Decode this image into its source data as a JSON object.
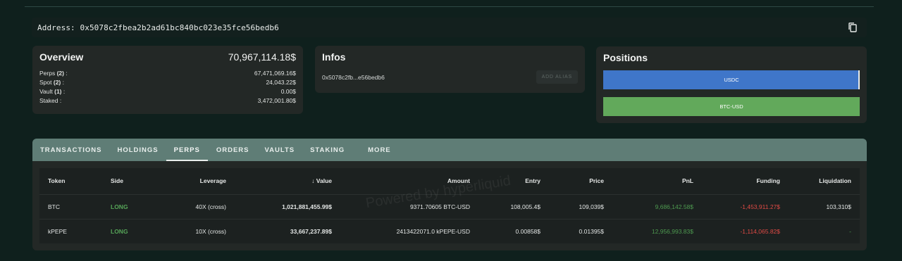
{
  "address_bar": {
    "label": "Address:",
    "value": "0x5078c2fbea2b2ad61bc840bc023e35fce56bedb6",
    "copy_icon": "copy-icon"
  },
  "overview": {
    "title": "Overview",
    "total": "70,967,114.18$",
    "rows": [
      {
        "label": "Perps",
        "count": "(2)",
        "suffix": " :",
        "value": "67,471,069.16$"
      },
      {
        "label": "Spot",
        "count": "(2)",
        "suffix": " :",
        "value": "24,043.22$"
      },
      {
        "label": "Vault",
        "count": "(1)",
        "suffix": " :",
        "value": "0.00$"
      },
      {
        "label": "Staked",
        "count": "",
        "suffix": " :",
        "value": "3,472,001.80$"
      }
    ]
  },
  "infos": {
    "title": "Infos",
    "short_address": "0x5078c2fb...e56bedb6",
    "alias_button": "ADD ALIAS"
  },
  "positions": {
    "title": "Positions",
    "bars": [
      {
        "label": "USDC",
        "color": "#3f76c9"
      },
      {
        "label": "BTC-USD",
        "color": "#62a95b"
      }
    ]
  },
  "tabs": [
    "TRANSACTIONS",
    "HOLDINGS",
    "PERPS",
    "ORDERS",
    "VAULTS",
    "STAKING",
    "MORE"
  ],
  "active_tab": "PERPS",
  "table": {
    "headers": [
      "Token",
      "Side",
      "Leverage",
      "Value",
      "Amount",
      "Entry",
      "Price",
      "PnL",
      "Funding",
      "Liquidation"
    ],
    "sort_icon": "arrow-down-icon",
    "rows": [
      {
        "token": "BTC",
        "side": "LONG",
        "leverage": "40X (cross)",
        "value": "1,021,881,455.99$",
        "amount": "9371.70605 BTC-USD",
        "entry": "108,005.4$",
        "price": "109,039$",
        "pnl": "9,686,142.58$",
        "funding": "-1,453,911.27$",
        "liquidation": "103,310$"
      },
      {
        "token": "kPEPE",
        "side": "LONG",
        "leverage": "10X (cross)",
        "value": "33,667,237.89$",
        "amount": "2413422071.0 kPEPE-USD",
        "entry": "0.00858$",
        "price": "0.01395$",
        "pnl": "12,956,993.83$",
        "funding": "-1,114,065.82$",
        "liquidation": "-"
      }
    ]
  },
  "watermark": "Powered by hyperliquid",
  "colors": {
    "tab_bar": "#5f7d76",
    "long": "#56a558",
    "pnl_positive": "#4e9a50",
    "funding_negative": "#e04a45"
  }
}
